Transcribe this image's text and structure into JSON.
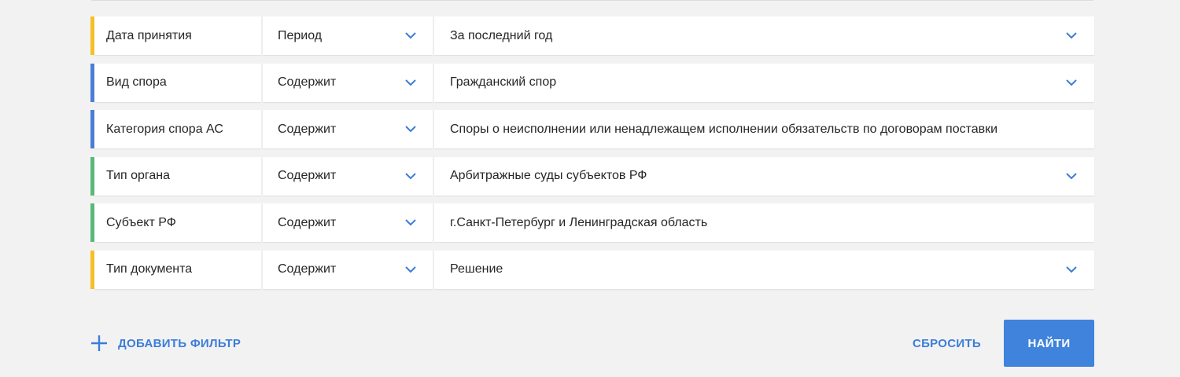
{
  "colors": {
    "accent_yellow": "#f6c026",
    "accent_blue": "#4b7fd6",
    "accent_green": "#5cb87a",
    "link_blue": "#3b7dd8",
    "button_blue": "#4083dc"
  },
  "filters": [
    {
      "field": "Дата принятия",
      "operator": "Период",
      "value": "За последний год",
      "accent": "yellow",
      "has_value_dropdown": true
    },
    {
      "field": "Вид спора",
      "operator": "Содержит",
      "value": "Гражданский спор",
      "accent": "blue",
      "has_value_dropdown": true
    },
    {
      "field": "Категория спора АС",
      "operator": "Содержит",
      "value": "Споры о неисполнении или ненадлежащем исполнении обязательств по договорам поставки",
      "accent": "blue",
      "has_value_dropdown": false
    },
    {
      "field": "Тип органа",
      "operator": "Содержит",
      "value": "Арбитражные суды субъектов РФ",
      "accent": "green",
      "has_value_dropdown": true
    },
    {
      "field": "Субъект РФ",
      "operator": "Содержит",
      "value": "г.Санкт-Петербург и Ленинградская область",
      "accent": "green",
      "has_value_dropdown": false
    },
    {
      "field": "Тип документа",
      "operator": "Содержит",
      "value": "Решение",
      "accent": "yellow",
      "has_value_dropdown": true
    }
  ],
  "actions": {
    "add_filter_label": "ДОБАВИТЬ ФИЛЬТР",
    "add_filter_icon": "plus-icon",
    "reset_label": "СБРОСИТЬ",
    "find_label": "НАЙТИ"
  }
}
